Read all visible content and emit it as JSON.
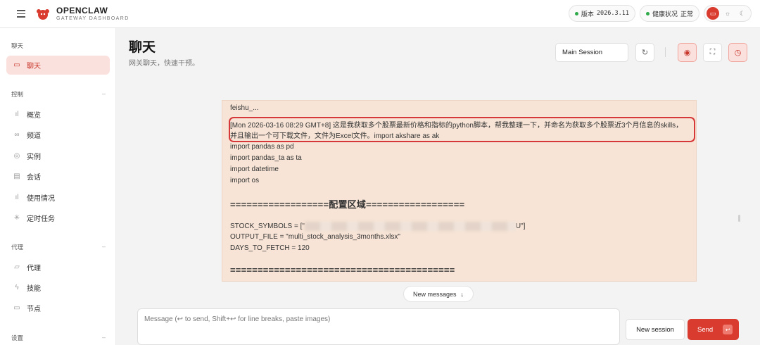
{
  "app": {
    "name": "OPENCLAW",
    "subtitle": "GATEWAY DASHBOARD"
  },
  "status": {
    "version_label": "版本",
    "version_value": "2026.3.11",
    "health_label": "健康状况",
    "health_value": "正常"
  },
  "sidebar": {
    "sections": [
      {
        "title": "聊天",
        "items": [
          {
            "label": "聊天",
            "icon": "chat-bubble-icon"
          }
        ]
      },
      {
        "title": "控制",
        "items": [
          {
            "label": "概览",
            "icon": "bar-chart-icon"
          },
          {
            "label": "频道",
            "icon": "link-icon"
          },
          {
            "label": "实例",
            "icon": "broadcast-icon"
          },
          {
            "label": "会话",
            "icon": "document-icon"
          },
          {
            "label": "使用情况",
            "icon": "bar-chart-icon"
          },
          {
            "label": "定时任务",
            "icon": "spinner-icon"
          }
        ]
      },
      {
        "title": "代理",
        "items": [
          {
            "label": "代理",
            "icon": "folder-icon"
          },
          {
            "label": "技能",
            "icon": "lightning-icon"
          },
          {
            "label": "节点",
            "icon": "monitor-icon"
          }
        ]
      },
      {
        "title": "设置",
        "items": []
      }
    ]
  },
  "main": {
    "title": "聊天",
    "subtitle": "网关聊天，快速干预。",
    "session_select": "Main Session"
  },
  "chat": {
    "sender": "feishu_...",
    "highlighted_message": "[Mon 2026-03-16 08:29 GMT+8] 这是我获取多个股票最新价格和指标的python脚本，帮我整理一下，并命名为获取多个股票近3个月信息的skills，并且输出一个可下载文件，文件为Excel文件。import akshare as ak",
    "code_lines": [
      "import pandas as pd",
      "import pandas_ta as ta",
      "import datetime",
      "import os"
    ],
    "section_header": "==================配置区域==================",
    "stock_symbols_prefix": "STOCK_SYMBOLS = [\"",
    "stock_symbols_suffix": "U\"]",
    "output_file": "OUTPUT_FILE = \"multi_stock_analysis_3months.xlsx\"",
    "days_to_fetch": "DAYS_TO_FETCH = 120",
    "separator": "========================================="
  },
  "new_messages_label": "New messages",
  "composer": {
    "placeholder": "Message (↩ to send, Shift+↩ for line breaks, paste images)",
    "new_session_label": "New session",
    "send_label": "Send"
  },
  "colors": {
    "accent": "#d93b2f",
    "chat_bg": "#f7e4d6",
    "highlight_border": "#d6383a"
  }
}
